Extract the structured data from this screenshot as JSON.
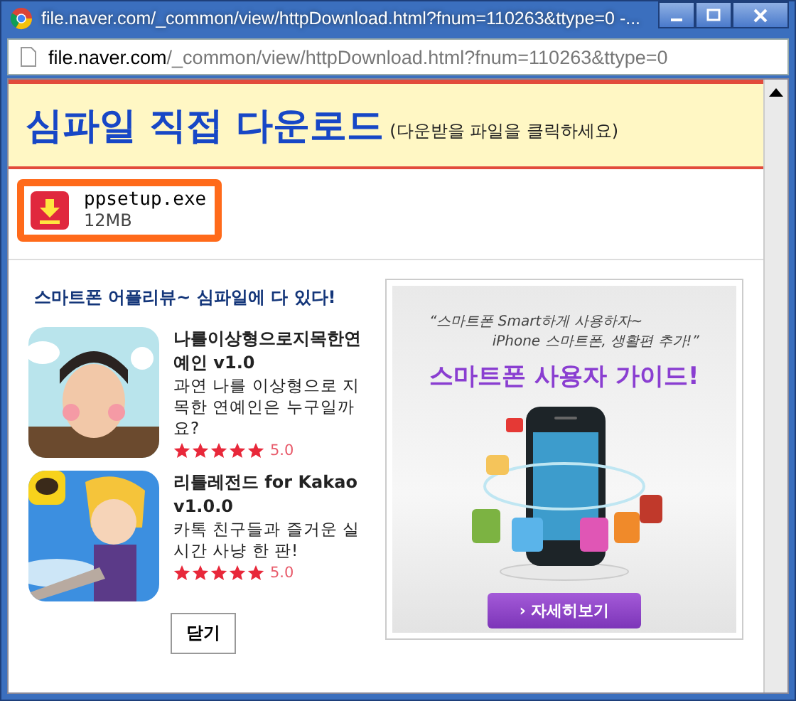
{
  "window": {
    "title": "file.naver.com/_common/view/httpDownload.html?fnum=110263&ttype=0 -..."
  },
  "address_bar": {
    "host": "file.naver.com",
    "path": "/_common/view/httpDownload.html?fnum=110263&ttype=0"
  },
  "header": {
    "title": "심파일 직접 다운로드",
    "hint": "(다운받을 파일을 클릭하세요)"
  },
  "file": {
    "name": "ppsetup.exe",
    "size": "12MB"
  },
  "apps_heading": "스마트폰 어플리뷰~ 심파일에 다 있다!",
  "apps": [
    {
      "kind": "picture",
      "title": "나를이상형으로지목한연예인 v1.0",
      "description": "과연 나를 이상형으로 지목한 연예인은 누구일까요?",
      "stars": 5,
      "rating": "5.0"
    },
    {
      "kind": "picture",
      "title": "리틀레전드 for Kakao v1.0.0",
      "description": "카톡 친구들과 즐거운 실시간 사냥 한 판!",
      "stars": 5,
      "rating": "5.0"
    }
  ],
  "banner": {
    "quote_line_1": "“스마트폰 Smart하게 사용하자~",
    "quote_line_2": "iPhone 스마트폰, 생활편 추가!”",
    "title": "스마트폰 사용자 가이드!",
    "button": "› 자세히보기"
  },
  "close_button": "닫기"
}
